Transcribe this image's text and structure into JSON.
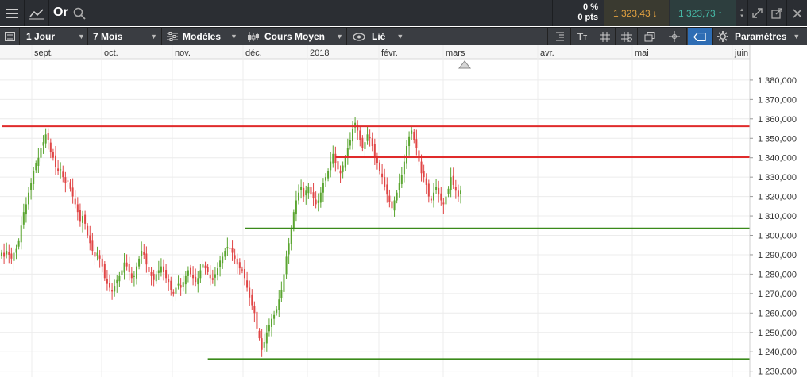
{
  "header": {
    "symbol": "Or",
    "change_percent": "0 %",
    "change_points": "0 pts",
    "bid_price": "1 323,43",
    "ask_price": "1 323,73",
    "colors": {
      "bid": "#e0a040",
      "ask": "#46b8a6"
    },
    "icons": [
      "menu-icon",
      "chart-line-icon",
      "search-icon",
      "collapse-icon",
      "close-icon",
      "expand-icon",
      "popout-icon",
      "settings-icon"
    ]
  },
  "toolbar": {
    "interval": "1 Jour",
    "period": "7 Mois",
    "templates": "Modèles",
    "chart_style": "Cours Moyen",
    "link": "Lié",
    "settings": "Paramètres"
  },
  "chart_data": {
    "type": "candlestick",
    "x_labels": [
      "sept.",
      "oct.",
      "nov.",
      "déc.",
      "2018",
      "févr.",
      "mars",
      "avr.",
      "mai",
      "juin"
    ],
    "y_ticks": [
      "1 380,000",
      "1 370,000",
      "1 360,000",
      "1 350,000",
      "1 340,000",
      "1 330,000",
      "1 320,000",
      "1 310,000",
      "1 300,000",
      "1 290,000",
      "1 280,000",
      "1 270,000",
      "1 260,000",
      "1 250,000",
      "1 240,000",
      "1 230,000"
    ],
    "y_tick_values": [
      1380,
      1370,
      1360,
      1350,
      1340,
      1330,
      1320,
      1310,
      1300,
      1290,
      1280,
      1270,
      1260,
      1250,
      1240,
      1230
    ],
    "ylim": [
      1227,
      1391
    ],
    "colors": {
      "up": "#5aa530",
      "down": "#e04545",
      "resistance": "#e02b2b",
      "support": "#3a8a1a"
    },
    "levels": [
      {
        "label": "1 356,175",
        "value": 1356.175,
        "kind": "resistance",
        "start": 0
      },
      {
        "label": "1 340,267",
        "value": 1340.267,
        "kind": "resistance",
        "start": 136
      },
      {
        "label": "1 303,605",
        "value": 1303.605,
        "kind": "support",
        "start": 99
      },
      {
        "label": "1 236,259",
        "value": 1236.259,
        "kind": "support",
        "start": 84
      }
    ],
    "close_series": [
      1291,
      1289,
      1292,
      1290,
      1288,
      1291,
      1293,
      1297,
      1305,
      1312,
      1316,
      1322,
      1327,
      1333,
      1337,
      1340,
      1345,
      1348,
      1352,
      1349,
      1343,
      1340,
      1335,
      1333,
      1334,
      1330,
      1327,
      1328,
      1324,
      1320,
      1316,
      1312,
      1307,
      1310,
      1306,
      1300,
      1296,
      1292,
      1289,
      1291,
      1288,
      1284,
      1278,
      1275,
      1273,
      1271,
      1274,
      1277,
      1279,
      1282,
      1286,
      1284,
      1281,
      1278,
      1279,
      1284,
      1288,
      1292,
      1290,
      1285,
      1281,
      1279,
      1277,
      1280,
      1282,
      1284,
      1281,
      1278,
      1276,
      1272,
      1270,
      1273,
      1275,
      1273,
      1276,
      1279,
      1282,
      1280,
      1278,
      1276,
      1278,
      1282,
      1285,
      1283,
      1281,
      1278,
      1277,
      1280,
      1283,
      1287,
      1289,
      1292,
      1294,
      1293,
      1291,
      1288,
      1285,
      1283,
      1282,
      1278,
      1273,
      1268,
      1264,
      1260,
      1252,
      1247,
      1241,
      1245,
      1250,
      1254,
      1257,
      1259,
      1262,
      1267,
      1272,
      1280,
      1289,
      1296,
      1303,
      1312,
      1318,
      1322,
      1325,
      1320,
      1323,
      1325,
      1321,
      1319,
      1316,
      1318,
      1322,
      1327,
      1330,
      1333,
      1338,
      1342,
      1337,
      1334,
      1332,
      1336,
      1340,
      1345,
      1349,
      1355,
      1358,
      1354,
      1349,
      1345,
      1348,
      1352,
      1350,
      1346,
      1341,
      1337,
      1333,
      1330,
      1325,
      1321,
      1317,
      1314,
      1318,
      1322,
      1327,
      1331,
      1338,
      1346,
      1351,
      1354,
      1349,
      1345,
      1338,
      1332,
      1330,
      1326,
      1320,
      1318,
      1322,
      1325,
      1321,
      1318,
      1316,
      1320,
      1324,
      1330,
      1326,
      1323,
      1320,
      1323
    ],
    "last_value": 1323.43
  }
}
